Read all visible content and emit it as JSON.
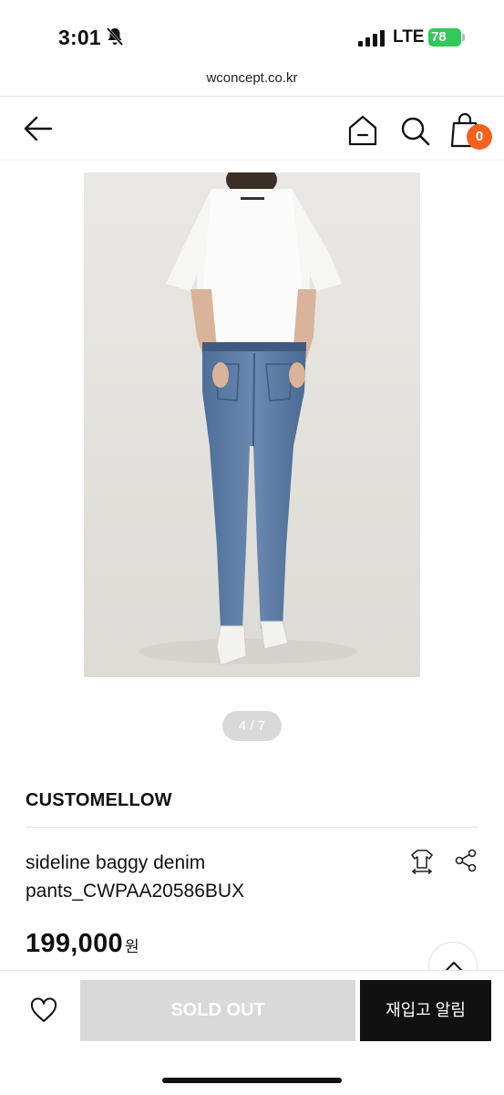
{
  "status_bar": {
    "time": "3:01",
    "network": "LTE",
    "battery": "78"
  },
  "browser": {
    "url": "wconcept.co.kr"
  },
  "header": {
    "cart_count": "0",
    "icons": [
      "back-arrow-icon",
      "home-icon",
      "search-icon",
      "shopping-bag-icon"
    ]
  },
  "gallery": {
    "counter": "4 / 7"
  },
  "product": {
    "brand": "CUSTOMELLOW",
    "title": "sideline baggy denim pants_CWPAA20586BUX",
    "price": "199,000",
    "currency": "원"
  },
  "actions": {
    "sold_out_label": "SOLD OUT",
    "restock_label": "재입고 알림"
  },
  "colors": {
    "accent": "#f4611f",
    "battery": "#34c759",
    "disabled_button": "#d9d9d9",
    "primary_button": "#111111"
  }
}
